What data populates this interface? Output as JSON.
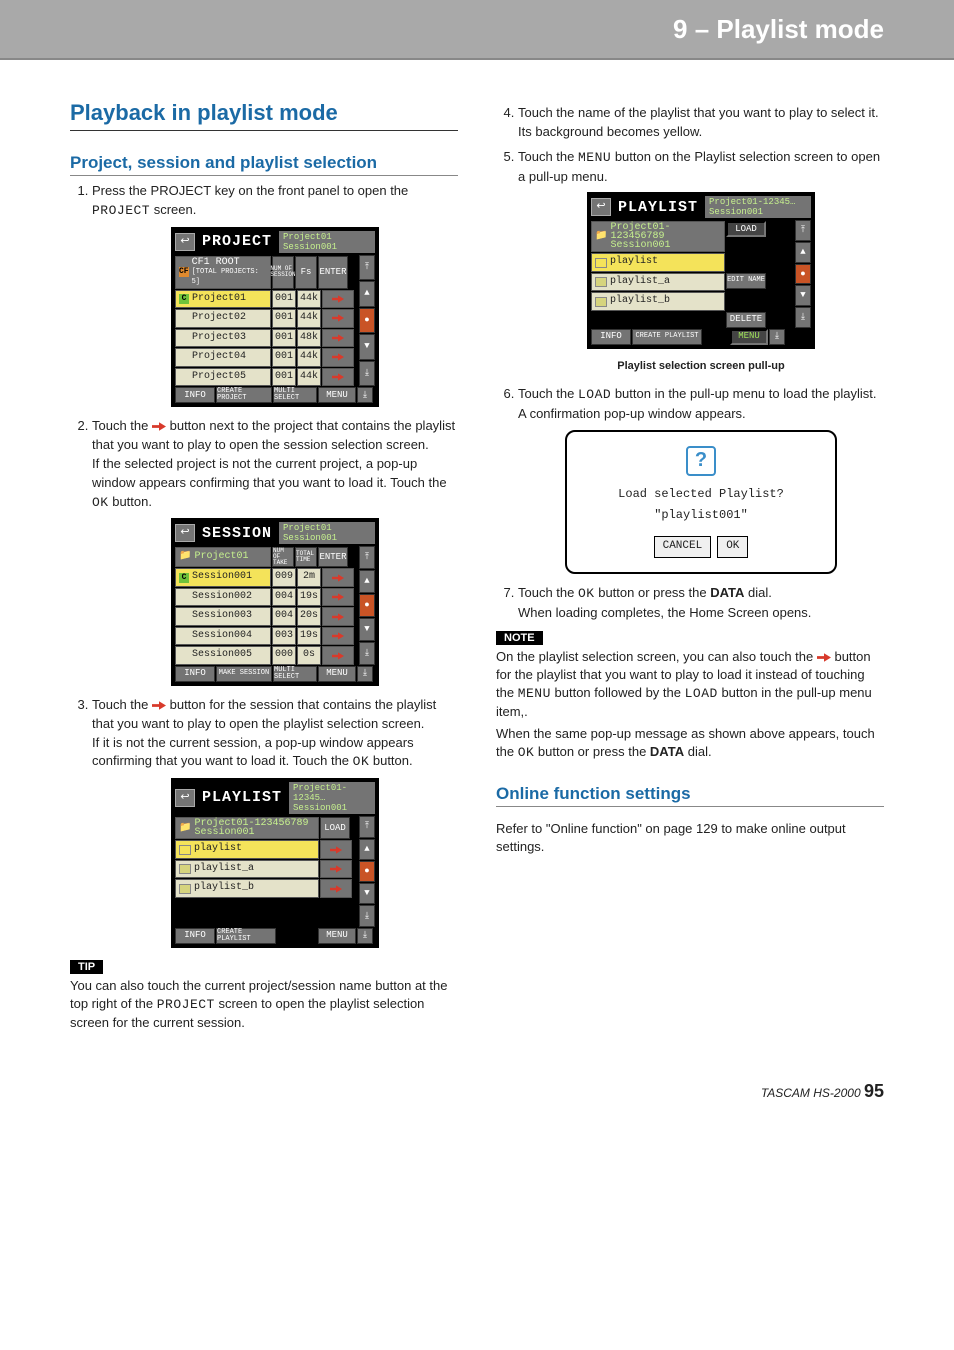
{
  "header": {
    "chapter_title": "9 – Playlist mode"
  },
  "section_title": "Playback in playlist mode",
  "subsection1": "Project, session and playlist selection",
  "steps_left": {
    "s1_a": "Press the PROJECT key on the front panel to open the ",
    "s1_b": "PROJECT",
    "s1_c": " screen.",
    "s2_a": "Touch the ",
    "s2_b": " button next to the project that contains the playlist that you want to play to open the session selection screen.",
    "s2_c": "If the selected project is not the current project, a pop-up window appears confirming that you want to load it. Touch the ",
    "s2_d": "OK",
    "s2_e": " button.",
    "s3_a": "Touch the ",
    "s3_b": " button for the session that contains the playlist that you want to play to open the playlist selection screen.",
    "s3_c": "If it is not the current session, a pop-up window appears confirming that you want to load it. Touch the ",
    "s3_d": "OK",
    "s3_e": " button."
  },
  "tip": {
    "label": "TIP",
    "text_a": "You can also touch the current project/session name button at the top right of the ",
    "text_b": "PROJECT",
    "text_c": " screen to open the playlist selection screen for the current session."
  },
  "steps_right": {
    "s4": "Touch the name of the playlist that you want to play to select it. Its background becomes yellow.",
    "s5_a": "Touch the ",
    "s5_b": "MENU",
    "s5_c": " button on the Playlist selection screen to open a pull-up menu.",
    "caption": "Playlist selection screen pull-up",
    "s6_a": "Touch the ",
    "s6_b": "LOAD",
    "s6_c": " button in the pull-up menu to load the playlist.",
    "s6_d": "A confirmation pop-up window appears.",
    "s7_a": "Touch the ",
    "s7_b": "OK",
    "s7_c": " button or press the ",
    "s7_d": "DATA",
    "s7_e": " dial.",
    "s7_f": "When loading completes, the Home Screen opens."
  },
  "note": {
    "label": "NOTE",
    "line1_a": "On the playlist selection screen, you can also touch the ",
    "line1_b": " button for the playlist that you want to play to load it instead of touching the ",
    "line1_c": "MENU",
    "line1_d": " button followed by the ",
    "line1_e": "LOAD",
    "line1_f": " button in the pull-up menu item,.",
    "line2_a": "When the same pop-up message as shown above appears, touch the ",
    "line2_b": "OK",
    "line2_c": " button or press the ",
    "line2_d": "DATA",
    "line2_e": " dial."
  },
  "subsection2": " Online function settings",
  "online_text": "Refer to \"Online function\" on page 129 to make online output settings.",
  "popup": {
    "line1": "Load selected Playlist?",
    "line2": "\"playlist001\"",
    "cancel": "CANCEL",
    "ok": "OK"
  },
  "lcd_project": {
    "title": "PROJECT",
    "path1": "Project01",
    "path2": "Session001",
    "root_line": "CF1 ROOT",
    "root_sub": "[TOTAL PROJECTS: 5]",
    "hdr": {
      "a": "NUM OF SESSION",
      "b": "Fs",
      "c": "ENTER"
    },
    "rows": [
      {
        "name": "Project01",
        "n": "001",
        "fs": "44k",
        "current": true
      },
      {
        "name": "Project02",
        "n": "001",
        "fs": "44k"
      },
      {
        "name": "Project03",
        "n": "001",
        "fs": "48k"
      },
      {
        "name": "Project04",
        "n": "001",
        "fs": "44k"
      },
      {
        "name": "Project05",
        "n": "001",
        "fs": "44k"
      }
    ],
    "footer": {
      "a": "INFO",
      "b": "CREATE PROJECT",
      "c": "MULTI SELECT",
      "d": "MENU"
    }
  },
  "lcd_session": {
    "title": "SESSION",
    "path1": "Project01",
    "path2": "Session001",
    "parent": "Project01",
    "hdr": {
      "a": "NUM OF TAKE",
      "b": "TOTAL TIME",
      "c": "ENTER"
    },
    "rows": [
      {
        "name": "Session001",
        "n": "009",
        "t": "2m",
        "current": true
      },
      {
        "name": "Session002",
        "n": "004",
        "t": "19s"
      },
      {
        "name": "Session003",
        "n": "004",
        "t": "20s"
      },
      {
        "name": "Session004",
        "n": "003",
        "t": "19s"
      },
      {
        "name": "Session005",
        "n": "000",
        "t": "0s"
      }
    ],
    "footer": {
      "a": "INFO",
      "b": "MAKE SESSION",
      "c": "MULTI SELECT",
      "d": "MENU"
    }
  },
  "lcd_playlist": {
    "title": "PLAYLIST",
    "path1": "Project01-12345…",
    "path2": "Session001",
    "parent_a": "Project01-123456789",
    "parent_b": "Session001",
    "rows": [
      {
        "name": "playlist",
        "current": true
      },
      {
        "name": "playlist_a"
      },
      {
        "name": "playlist_b"
      }
    ],
    "load": "LOAD",
    "footer": {
      "a": "INFO",
      "b": "CREATE PLAYLIST",
      "d": "MENU"
    }
  },
  "lcd_playlist_menu": {
    "title": "PLAYLIST",
    "path1": "Project01-12345…",
    "path2": "Session001",
    "parent_a": "Project01-123456789",
    "parent_b": "Session001",
    "rows": [
      {
        "name": "playlist",
        "current": true
      },
      {
        "name": "playlist_a"
      },
      {
        "name": "playlist_b"
      }
    ],
    "menu": {
      "load": "LOAD",
      "edit": "EDIT NAME",
      "delete": "DELETE"
    },
    "footer": {
      "a": "INFO",
      "b": "CREATE PLAYLIST",
      "d": "MENU"
    }
  },
  "footer": {
    "brand": "TASCAM HS-2000",
    "page": "95"
  }
}
